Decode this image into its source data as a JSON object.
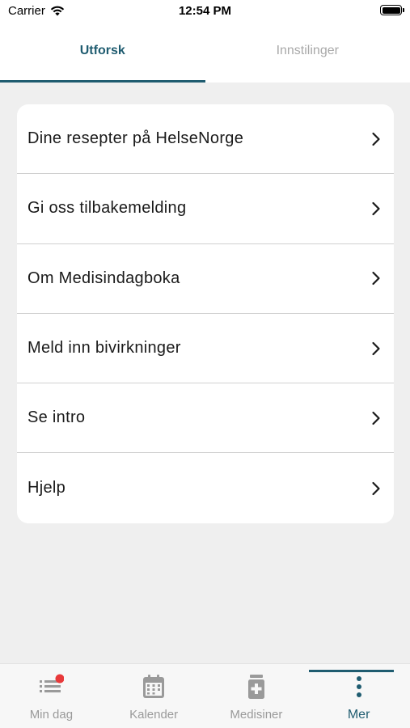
{
  "status_bar": {
    "carrier": "Carrier",
    "time": "12:54 PM"
  },
  "top_tabs": [
    {
      "label": "Utforsk",
      "active": true
    },
    {
      "label": "Innstilinger",
      "active": false
    }
  ],
  "menu": {
    "items": [
      {
        "label": "Dine resepter på HelseNorge",
        "icon": "chevron-right-icon"
      },
      {
        "label": "Gi oss tilbakemelding",
        "icon": "chevron-right-icon"
      },
      {
        "label": "Om Medisindagboka",
        "icon": "chevron-right-icon"
      },
      {
        "label": "Meld inn bivirkninger",
        "icon": "chevron-right-icon"
      },
      {
        "label": "Se intro",
        "icon": "chevron-right-icon"
      },
      {
        "label": "Hjelp",
        "icon": "chevron-right-icon"
      }
    ]
  },
  "bottom_nav": {
    "items": [
      {
        "label": "Min dag",
        "icon": "list-icon",
        "badge": true
      },
      {
        "label": "Kalender",
        "icon": "calendar-icon"
      },
      {
        "label": "Medisiner",
        "icon": "medicine-icon"
      },
      {
        "label": "Mer",
        "icon": "more-vertical-icon",
        "active": true
      }
    ]
  },
  "colors": {
    "accent": "#1f5c70",
    "inactive": "#a9a9a9",
    "background": "#efefef",
    "badge": "#e8393a"
  }
}
